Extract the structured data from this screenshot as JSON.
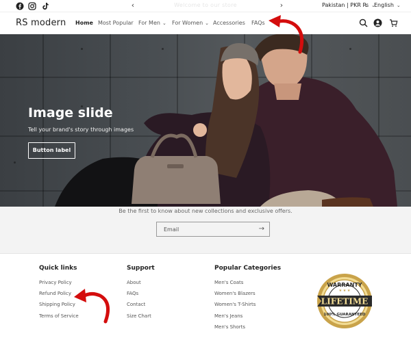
{
  "announcement": {
    "text": "Welcome to our store",
    "prev_symbol": "‹",
    "next_symbol": "›",
    "social": [
      "facebook-icon",
      "instagram-icon",
      "tiktok-icon"
    ],
    "country_label": "Pakistan | PKR ₨",
    "language_label": "English"
  },
  "header": {
    "logo": "RS modern",
    "nav": [
      {
        "label": "Home",
        "active": true
      },
      {
        "label": "Most Popular"
      },
      {
        "label": "For Men",
        "dropdown": true
      },
      {
        "label": "For Women",
        "dropdown": true
      },
      {
        "label": "Accessories"
      },
      {
        "label": "FAQs"
      }
    ],
    "icons": [
      "search-icon",
      "account-icon",
      "cart-icon"
    ]
  },
  "hero": {
    "title": "Image slide",
    "subtitle": "Tell your brand's story through images",
    "button_label": "Button label"
  },
  "newsletter": {
    "text": "Be the first to know about new collections and exclusive offers.",
    "email_placeholder": "Email",
    "submit_symbol": "→"
  },
  "footer": {
    "columns": [
      {
        "title": "Quick links",
        "links": [
          "Privacy Policy",
          "Refund Policy",
          "Shipping Policy",
          "Terms of Service"
        ]
      },
      {
        "title": "Support",
        "links": [
          "About",
          "FAQs",
          "Contact",
          "Size Chart"
        ]
      },
      {
        "title": "Popular Categories",
        "links": [
          "Men's Coats",
          "Women's Blazers",
          "Women's T-Shirts",
          "Men's Jeans",
          "Men's Shorts"
        ]
      }
    ],
    "badge": {
      "top": "WARRANTY",
      "main": "LIFETIME",
      "bottom": "100% GUARANTEED"
    }
  },
  "colors": {
    "accent_red": "#d40d0d",
    "badge_gold": "#c9a34a",
    "badge_dark": "#2a2a2a",
    "newsletter_bg": "#f3f3f3"
  }
}
